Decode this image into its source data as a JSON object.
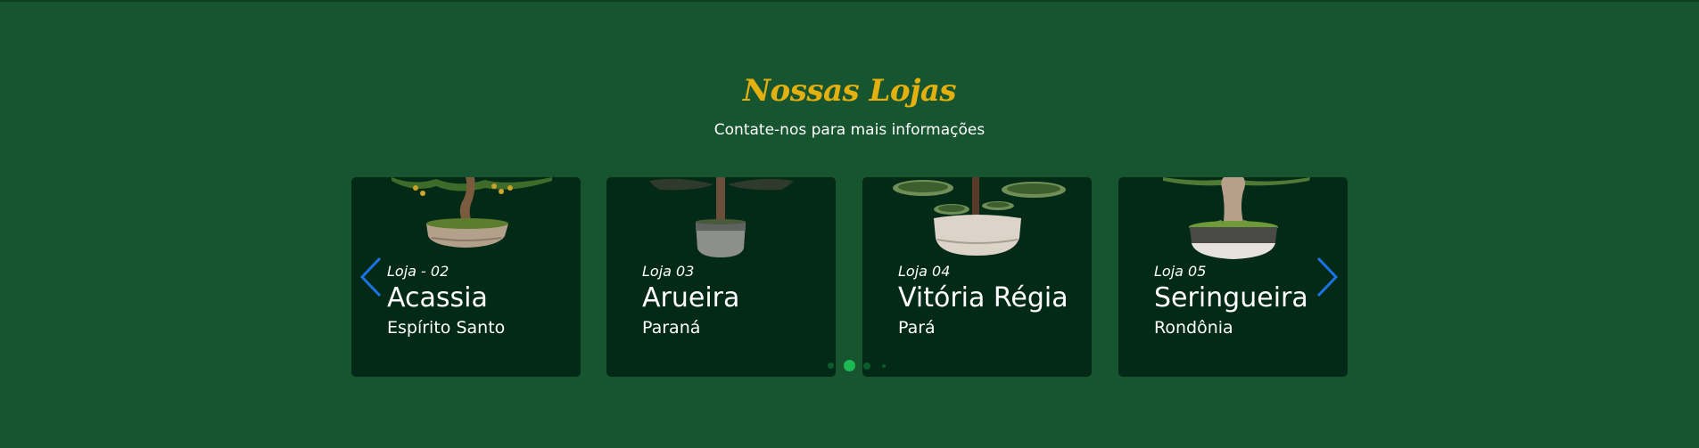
{
  "header": {
    "title": "Nossas Lojas",
    "subtitle": "Contate-nos para mais informações"
  },
  "carousel": {
    "prev_icon": "chevron-left-icon",
    "next_icon": "chevron-right-icon",
    "arrow_color": "#1a73e8",
    "active_slide_index": 1,
    "slide_count": 4,
    "cards": [
      {
        "store": "Loja - 02",
        "name": "Acassia",
        "state": "Espírito Santo",
        "image_icon": "bonsai-tree-icon"
      },
      {
        "store": "Loja 03",
        "name": "Arueira",
        "state": "Paraná",
        "image_icon": "potted-palm-icon"
      },
      {
        "store": "Loja 04",
        "name": "Vitória Régia",
        "state": "Pará",
        "image_icon": "water-lily-pot-icon"
      },
      {
        "store": "Loja 05",
        "name": "Seringueira",
        "state": "Rondônia",
        "image_icon": "bonsai-tree-icon"
      }
    ]
  },
  "colors": {
    "background": "#165530",
    "card": "#032a16",
    "title": "#e3b00f",
    "dot_active": "#1db954"
  }
}
